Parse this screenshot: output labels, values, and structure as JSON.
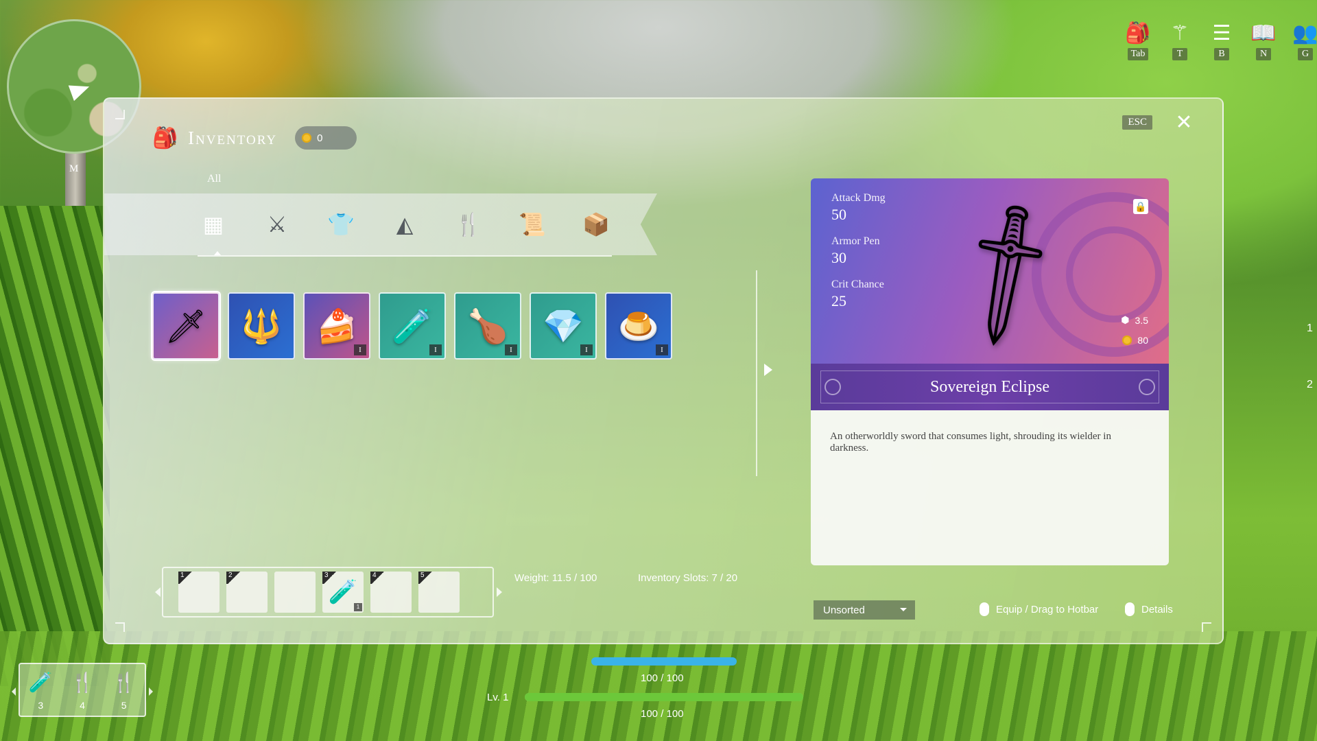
{
  "minimap": {
    "key": "M"
  },
  "shortcuts": [
    {
      "icon": "backpack-icon",
      "glyph": "🎒",
      "key": "Tab"
    },
    {
      "icon": "skill-tree-icon",
      "glyph": "⚚",
      "key": "T"
    },
    {
      "icon": "storage-icon",
      "glyph": "☰",
      "key": "B"
    },
    {
      "icon": "journal-icon",
      "glyph": "📖",
      "key": "N"
    },
    {
      "icon": "guild-icon",
      "glyph": "👥",
      "key": "G"
    }
  ],
  "inventory": {
    "title": "Inventory",
    "coins": "0",
    "esc_label": "ESC",
    "category_label": "All",
    "categories": [
      {
        "name": "all",
        "glyph": "▦"
      },
      {
        "name": "weapons",
        "glyph": "⚔"
      },
      {
        "name": "armor",
        "glyph": "👕"
      },
      {
        "name": "materials",
        "glyph": "◭"
      },
      {
        "name": "food",
        "glyph": "🍴"
      },
      {
        "name": "quest",
        "glyph": "📜"
      },
      {
        "name": "misc",
        "glyph": "📦"
      }
    ],
    "items": [
      {
        "name": "Sovereign Eclipse",
        "icon": "sword-icon",
        "glyph": "🗡",
        "rarity": "legend",
        "tier": "",
        "selected": true
      },
      {
        "name": "trident",
        "icon": "trident-icon",
        "glyph": "🔱",
        "rarity": "blue",
        "tier": ""
      },
      {
        "name": "cake",
        "icon": "cake-icon",
        "glyph": "🍰",
        "rarity": "purple",
        "tier": "I"
      },
      {
        "name": "potion",
        "icon": "potion-icon",
        "glyph": "🧪",
        "rarity": "teal",
        "tier": "I"
      },
      {
        "name": "roast chicken",
        "icon": "roast-chicken-icon",
        "glyph": "🍗",
        "rarity": "teal",
        "tier": "I"
      },
      {
        "name": "crystal",
        "icon": "crystal-icon",
        "glyph": "💎",
        "rarity": "teal",
        "tier": "I"
      },
      {
        "name": "pudding",
        "icon": "pudding-icon",
        "glyph": "🍮",
        "rarity": "blue",
        "tier": "I"
      }
    ]
  },
  "detail": {
    "stats": [
      {
        "label": "Attack Dmg",
        "value": "50"
      },
      {
        "label": "Armor Pen",
        "value": "30"
      },
      {
        "label": "Crit Chance",
        "value": "25"
      }
    ],
    "weight": "3.5",
    "price": "80",
    "name": "Sovereign Eclipse",
    "description": "An otherworldly sword that consumes light, shrouding its wielder in darkness."
  },
  "hotbar": {
    "slots": [
      {
        "num": "1",
        "glyph": "",
        "count": ""
      },
      {
        "num": "2",
        "glyph": "",
        "count": ""
      },
      {
        "num": "",
        "glyph": "",
        "count": ""
      },
      {
        "num": "3",
        "glyph": "🧪",
        "count": "1"
      },
      {
        "num": "4",
        "glyph": "",
        "count": ""
      },
      {
        "num": "5",
        "glyph": "",
        "count": ""
      }
    ]
  },
  "footer": {
    "weight": "Weight: 11.5 / 100",
    "slots": "Inventory Slots: 7 / 20",
    "sort": "Unsorted",
    "equip_hint": "Equip / Drag to Hotbar",
    "details_hint": "Details"
  },
  "hud": {
    "quickbar": [
      {
        "icon": "potion-icon",
        "glyph": "🧪",
        "num": "3"
      },
      {
        "icon": "utensils-icon",
        "glyph": "🍴",
        "num": "4"
      },
      {
        "icon": "utensils-icon",
        "glyph": "🍴",
        "num": "5"
      }
    ],
    "mana": "100 / 100",
    "level": "Lv. 1",
    "hp": "100 / 100",
    "edge_numbers": [
      "1",
      "2"
    ]
  }
}
